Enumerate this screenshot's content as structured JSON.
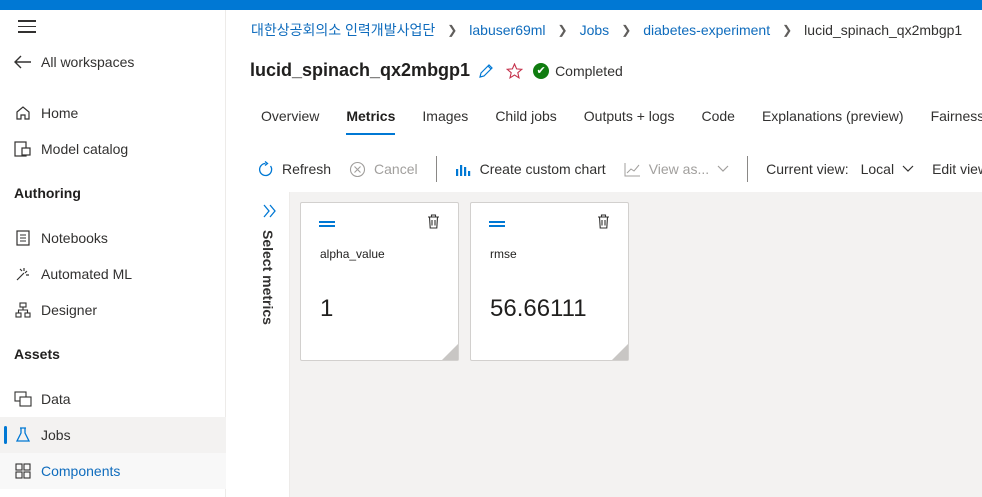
{
  "sidebar": {
    "all_workspaces": "All workspaces",
    "items_top": [
      {
        "label": "Home",
        "icon": "home-icon"
      },
      {
        "label": "Model catalog",
        "icon": "model-catalog-icon"
      }
    ],
    "section_authoring": "Authoring",
    "items_authoring": [
      {
        "label": "Notebooks",
        "icon": "notebook-icon"
      },
      {
        "label": "Automated ML",
        "icon": "automl-icon"
      },
      {
        "label": "Designer",
        "icon": "designer-icon"
      }
    ],
    "section_assets": "Assets",
    "items_assets": [
      {
        "label": "Data",
        "icon": "data-icon"
      },
      {
        "label": "Jobs",
        "icon": "jobs-icon",
        "active": true
      },
      {
        "label": "Components",
        "icon": "components-icon"
      }
    ]
  },
  "breadcrumb": [
    "대한상공회의소 인력개발사업단",
    "labuser69ml",
    "Jobs",
    "diabetes-experiment",
    "lucid_spinach_qx2mbgp1"
  ],
  "job": {
    "title": "lucid_spinach_qx2mbgp1",
    "status": "Completed"
  },
  "tabs": [
    "Overview",
    "Metrics",
    "Images",
    "Child jobs",
    "Outputs + logs",
    "Code",
    "Explanations (preview)",
    "Fairness"
  ],
  "active_tab": "Metrics",
  "toolbar": {
    "refresh": "Refresh",
    "cancel": "Cancel",
    "create_chart": "Create custom chart",
    "view_as": "View as...",
    "current_view_label": "Current view:",
    "current_view_value": "Local",
    "edit_view": "Edit view"
  },
  "panel": {
    "select_metrics": "Select metrics"
  },
  "metrics": [
    {
      "name": "alpha_value",
      "value": "1"
    },
    {
      "name": "rmse",
      "value": "56.66111"
    }
  ],
  "colors": {
    "accent": "#0078d4",
    "success": "#107c10",
    "link": "#0f6cbd"
  }
}
